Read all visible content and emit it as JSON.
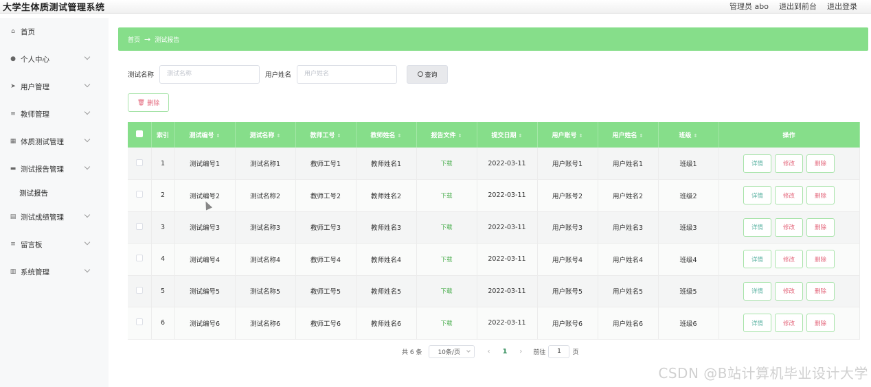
{
  "app": {
    "title": "大学生体质测试管理系统"
  },
  "top_links": {
    "admin": "管理员 abo",
    "back_front": "退出到前台",
    "logout": "退出登录"
  },
  "sidebar": {
    "items": [
      {
        "label": "首页",
        "icon": "home-icon",
        "glyph": "⌂",
        "has_children": false
      },
      {
        "label": "个人中心",
        "icon": "user-icon",
        "glyph": "●",
        "has_children": true
      },
      {
        "label": "用户管理",
        "icon": "send-icon",
        "glyph": "➤",
        "has_children": true
      },
      {
        "label": "教师管理",
        "icon": "list-icon",
        "glyph": "≡",
        "has_children": true
      },
      {
        "label": "体质测试管理",
        "icon": "grid-icon",
        "glyph": "▦",
        "has_children": true
      },
      {
        "label": "测试报告管理",
        "icon": "message-icon",
        "glyph": "▬",
        "has_children": true
      },
      {
        "label": "测试报告",
        "icon": "",
        "glyph": "",
        "submenu": true
      },
      {
        "label": "测试成绩管理",
        "icon": "document-icon",
        "glyph": "▤",
        "has_children": true
      },
      {
        "label": "留言板",
        "icon": "menu-icon",
        "glyph": "≡",
        "has_children": true
      },
      {
        "label": "系统管理",
        "icon": "chart-icon",
        "glyph": "▥",
        "has_children": true
      }
    ]
  },
  "breadcrumb": {
    "home": "首页",
    "arrow": "→",
    "current": "测试报告"
  },
  "search": {
    "name_label": "测试名称",
    "name_placeholder": "测试名称",
    "user_label": "用户姓名",
    "user_placeholder": "用户姓名",
    "query_label": "查询"
  },
  "actions": {
    "delete_label": "删除",
    "delete_glyph": "🗑"
  },
  "table": {
    "columns": [
      "索引",
      "测试编号",
      "测试名称",
      "教师工号",
      "教师姓名",
      "报告文件",
      "提交日期",
      "用户账号",
      "用户姓名",
      "班级",
      "操作"
    ],
    "rows": [
      {
        "index": "1",
        "test_no": "测试编号1",
        "test_name": "测试名称1",
        "teacher_no": "教师工号1",
        "teacher_name": "教师姓名1",
        "file": "下载",
        "date": "2022-03-11",
        "account": "用户账号1",
        "username": "用户姓名1",
        "class": "班级1"
      },
      {
        "index": "2",
        "test_no": "测试编号2",
        "test_name": "测试名称2",
        "teacher_no": "教师工号2",
        "teacher_name": "教师姓名2",
        "file": "下载",
        "date": "2022-03-11",
        "account": "用户账号2",
        "username": "用户姓名2",
        "class": "班级2"
      },
      {
        "index": "3",
        "test_no": "测试编号3",
        "test_name": "测试名称3",
        "teacher_no": "教师工号3",
        "teacher_name": "教师姓名3",
        "file": "下载",
        "date": "2022-03-11",
        "account": "用户账号3",
        "username": "用户姓名3",
        "class": "班级3"
      },
      {
        "index": "4",
        "test_no": "测试编号4",
        "test_name": "测试名称4",
        "teacher_no": "教师工号4",
        "teacher_name": "教师姓名4",
        "file": "下载",
        "date": "2022-03-11",
        "account": "用户账号4",
        "username": "用户姓名4",
        "class": "班级4"
      },
      {
        "index": "5",
        "test_no": "测试编号5",
        "test_name": "测试名称5",
        "teacher_no": "教师工号5",
        "teacher_name": "教师姓名5",
        "file": "下载",
        "date": "2022-03-11",
        "account": "用户账号5",
        "username": "用户姓名5",
        "class": "班级5"
      },
      {
        "index": "6",
        "test_no": "测试编号6",
        "test_name": "测试名称6",
        "teacher_no": "教师工号6",
        "teacher_name": "教师姓名6",
        "file": "下载",
        "date": "2022-03-11",
        "account": "用户账号6",
        "username": "用户姓名6",
        "class": "班级6"
      }
    ],
    "row_actions": {
      "detail": "详情",
      "edit": "修改",
      "delete": "删除"
    }
  },
  "pagination": {
    "total": "共 6 条",
    "page_size": "10条/页",
    "prev": "‹",
    "current": "1",
    "next": "›",
    "goto_label": "前往",
    "goto_value": "1",
    "page_suffix": "页"
  },
  "watermark": "CSDN @B站计算机毕业设计大学",
  "colors": {
    "accent_green": "#86de8a",
    "danger_text": "#e3657a",
    "detail_text": "#5cb3a3"
  }
}
